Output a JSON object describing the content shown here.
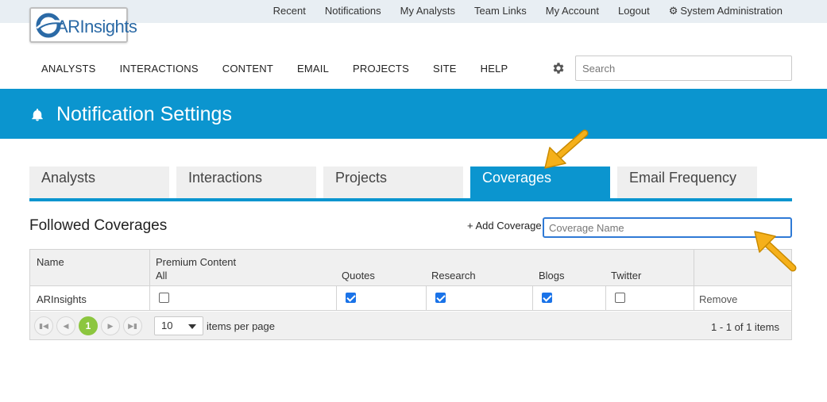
{
  "brand": {
    "logo_text": "ARInsights"
  },
  "top_links": [
    "Recent",
    "Notifications",
    "My Analysts",
    "Team Links",
    "My Account",
    "Logout"
  ],
  "system_admin": "System Administration",
  "main_nav": [
    "ANALYSTS",
    "INTERACTIONS",
    "CONTENT",
    "EMAIL",
    "PROJECTS",
    "SITE",
    "HELP"
  ],
  "search": {
    "placeholder": "Search"
  },
  "page_title": "Notification Settings",
  "tabs": [
    "Analysts",
    "Interactions",
    "Projects",
    "Coverages",
    "Email Frequency"
  ],
  "active_tab": "Coverages",
  "section": {
    "title": "Followed Coverages",
    "add_label": "+ Add Coverage",
    "input_placeholder": "Coverage Name"
  },
  "table": {
    "headers": {
      "name": "Name",
      "premium": "Premium Content",
      "all": "All",
      "quotes": "Quotes",
      "research": "Research",
      "blogs": "Blogs",
      "twitter": "Twitter"
    },
    "rows": [
      {
        "name": "ARInsights",
        "all": false,
        "quotes": true,
        "research": true,
        "blogs": true,
        "twitter": false,
        "action": "Remove"
      }
    ]
  },
  "pager": {
    "current_page": "1",
    "page_size": "10",
    "per_page_label": "items per page",
    "info": "1 - 1 of 1 items"
  },
  "colors": {
    "brand_blue": "#0b95cf",
    "page_green": "#8cc63f",
    "arrow_orange": "#f5b01a"
  }
}
